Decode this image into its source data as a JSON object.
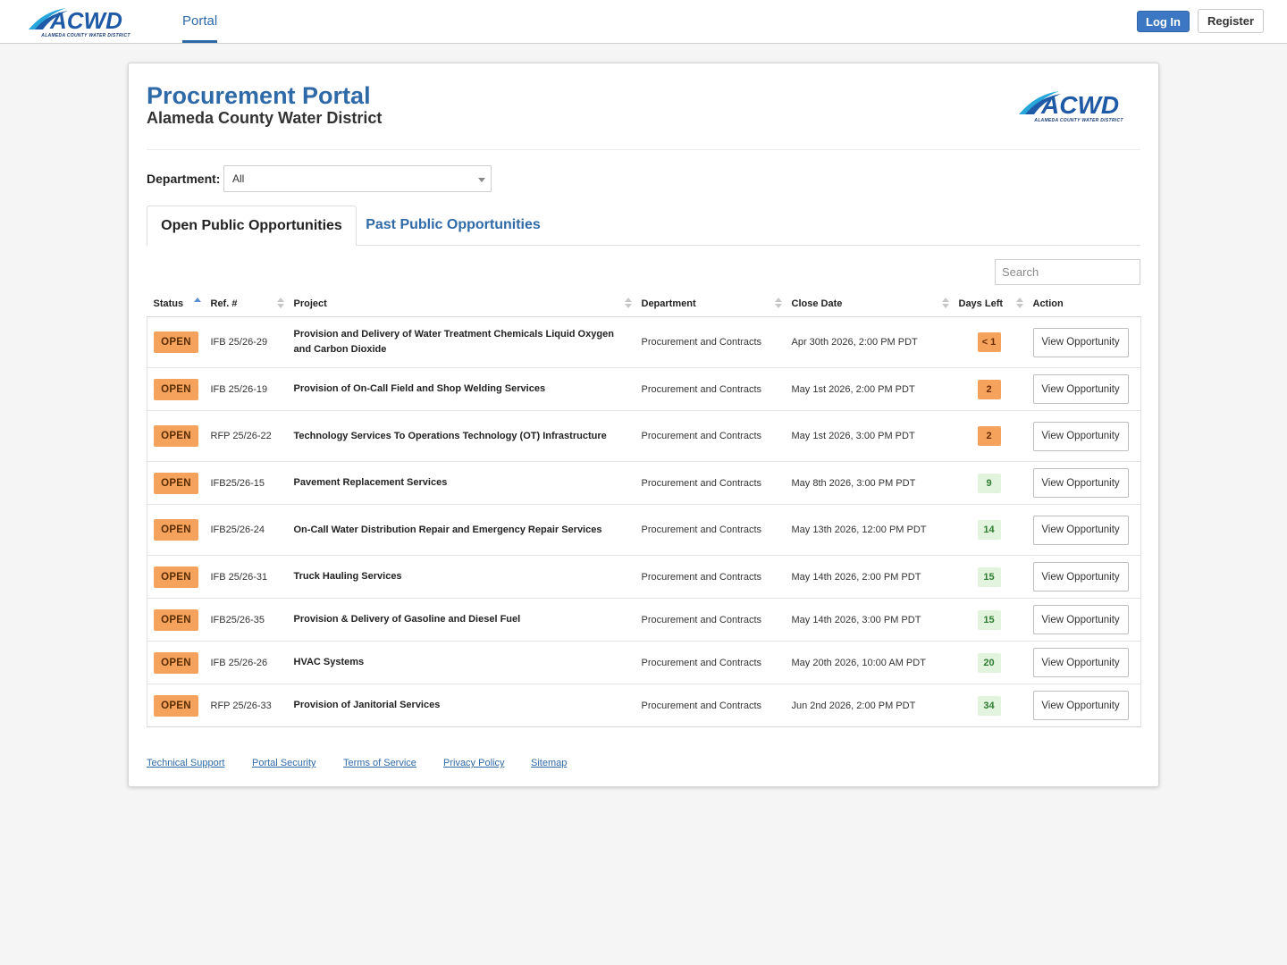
{
  "brand": {
    "logo_text": "ACWD",
    "logo_subtext": "ALAMEDA COUNTY WATER DISTRICT"
  },
  "nav": {
    "portal_link": "Portal",
    "login": "Log In",
    "register": "Register"
  },
  "header": {
    "title": "Procurement Portal",
    "subtitle": "Alameda County Water District"
  },
  "filter": {
    "department_label": "Department:",
    "department_value": "All"
  },
  "tabs": {
    "open": "Open Public Opportunities",
    "past": "Past Public Opportunities"
  },
  "search": {
    "placeholder": "Search"
  },
  "table": {
    "columns": [
      "Status",
      "Ref. #",
      "Project",
      "Department",
      "Close Date",
      "Days Left",
      "Action"
    ],
    "rows": [
      {
        "status": "OPEN",
        "ref": "IFB 25/26-29",
        "project": "Provision and Delivery of Water Treatment Chemicals Liquid Oxygen and Carbon Dioxide",
        "department": "Procurement and Contracts",
        "close_date": "Apr 30th 2026, 2:00 PM PDT",
        "days_left": "< 1",
        "action": "View Opportunity"
      },
      {
        "status": "OPEN",
        "ref": "IFB 25/26-19",
        "project": "Provision of On-Call Field and Shop Welding Services",
        "department": "Procurement and Contracts",
        "close_date": "May 1st 2026, 2:00 PM PDT",
        "days_left": "2",
        "action": "View Opportunity"
      },
      {
        "status": "OPEN",
        "ref": "RFP 25/26-22",
        "project": "Technology Services To Operations Technology (OT) Infrastructure",
        "department": "Procurement and Contracts",
        "close_date": "May 1st 2026, 3:00 PM PDT",
        "days_left": "2",
        "action": "View Opportunity"
      },
      {
        "status": "OPEN",
        "ref": "IFB25/26-15",
        "project": "Pavement Replacement Services",
        "department": "Procurement and Contracts",
        "close_date": "May 8th 2026, 3:00 PM PDT",
        "days_left": "9",
        "action": "View Opportunity"
      },
      {
        "status": "OPEN",
        "ref": "IFB25/26-24",
        "project": "On-Call Water Distribution Repair and Emergency Repair Services",
        "department": "Procurement and Contracts",
        "close_date": "May 13th 2026, 12:00 PM PDT",
        "days_left": "14",
        "action": "View Opportunity"
      },
      {
        "status": "OPEN",
        "ref": "IFB 25/26-31",
        "project": "Truck Hauling Services",
        "department": "Procurement and Contracts",
        "close_date": "May 14th 2026, 2:00 PM PDT",
        "days_left": "15",
        "action": "View Opportunity"
      },
      {
        "status": "OPEN",
        "ref": "IFB25/26-35",
        "project": "Provision & Delivery of Gasoline and Diesel Fuel",
        "department": "Procurement and Contracts",
        "close_date": "May 14th 2026, 3:00 PM PDT",
        "days_left": "15",
        "action": "View Opportunity"
      },
      {
        "status": "OPEN",
        "ref": "IFB 25/26-26",
        "project": "HVAC Systems",
        "department": "Procurement and Contracts",
        "close_date": "May 20th 2026, 10:00 AM PDT",
        "days_left": "20",
        "action": "View Opportunity"
      },
      {
        "status": "OPEN",
        "ref": "RFP 25/26-33",
        "project": "Provision of Janitorial Services",
        "department": "Procurement and Contracts",
        "close_date": "Jun 2nd 2026, 2:00 PM PDT",
        "days_left": "34",
        "action": "View Opportunity"
      }
    ]
  },
  "footer": {
    "links": [
      "Technical Support",
      "Portal Security",
      "Terms of Service",
      "Privacy Policy",
      "Sitemap"
    ]
  },
  "colors": {
    "brand_blue": "#2f6aa8",
    "login_blue": "#3b77c3",
    "open_badge": "#f4a25c",
    "days_ok_bg": "#e2f3de",
    "days_ok_text": "#2f7d32"
  },
  "icons": {
    "logo": "acwd-logo",
    "sort": "sort-icon",
    "dropdown": "chevron-down-icon"
  }
}
